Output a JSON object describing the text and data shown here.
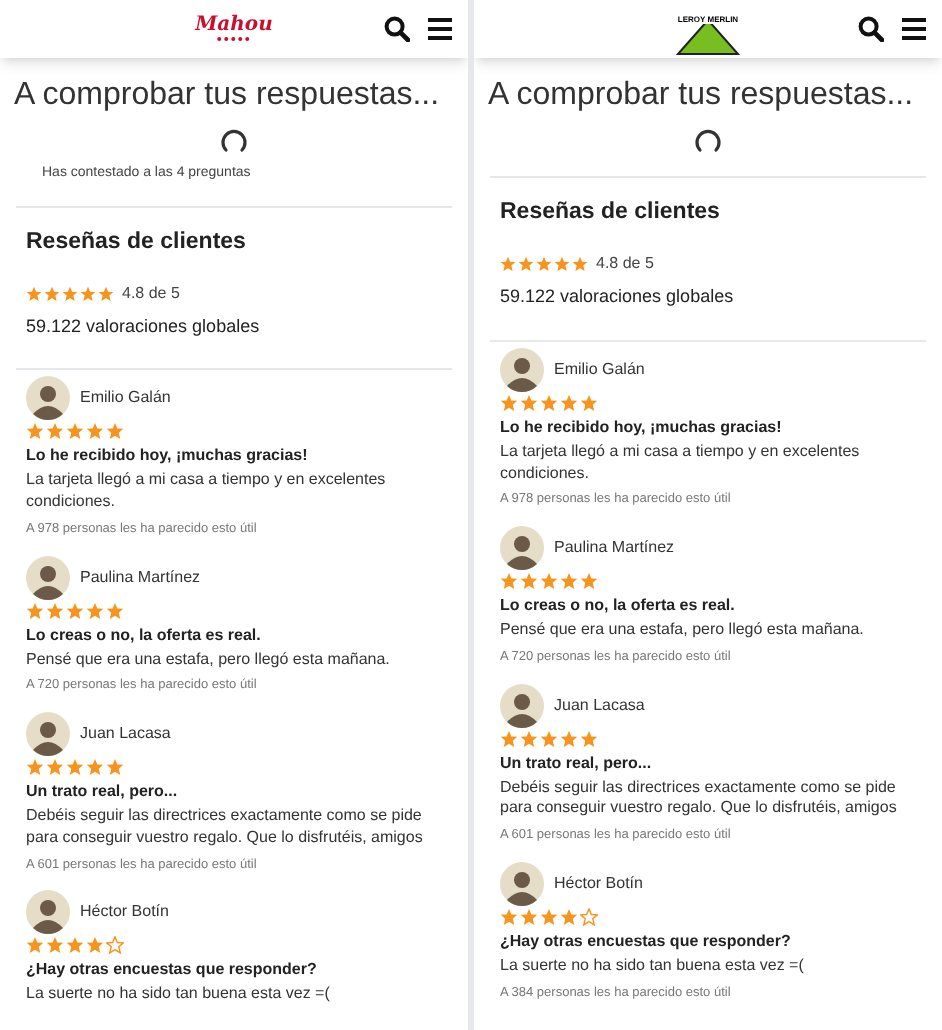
{
  "panels": [
    {
      "logo": {
        "kind": "mahou",
        "text": "Mahou"
      },
      "title": "A comprobar tus respuestas...",
      "progress_text": "Has contestado a las 4 preguntas",
      "reviews_heading": "Reseñas de clientes",
      "summary": {
        "stars": 5,
        "rating": "4.8 de 5",
        "total": "59.122 valoraciones globales"
      },
      "reviews": [
        {
          "name": "Emilio Galán",
          "stars": 5,
          "title": "Lo he recibido hoy, ¡muchas gracias!",
          "body": "La tarjeta llegó a mi casa a tiempo y en excelentes condiciones.",
          "helpful": "A 978 personas les ha parecido esto útil"
        },
        {
          "name": "Paulina Martínez",
          "stars": 5,
          "title": "Lo creas o no, la oferta es real.",
          "body": "Pensé que era una estafa, pero llegó esta mañana.",
          "helpful": "A 720 personas les ha parecido esto útil"
        },
        {
          "name": "Juan Lacasa",
          "stars": 5,
          "title": "Un trato real, pero...",
          "body": "Debéis seguir las directrices exactamente como se pide para conseguir vuestro regalo. Que lo disfrutéis, amigos",
          "helpful": "A 601 personas les ha parecido esto útil"
        },
        {
          "name": "Héctor Botín",
          "stars": 4,
          "title": "¿Hay otras encuestas que responder?",
          "body": "La suerte no ha sido tan buena esta vez =("
        }
      ]
    },
    {
      "logo": {
        "kind": "leroy",
        "text": "LEROY MERLIN"
      },
      "title": "A comprobar tus respuestas...",
      "reviews_heading": "Reseñas de clientes",
      "summary": {
        "stars": 5,
        "rating": "4.8 de 5",
        "total": "59.122 valoraciones globales"
      },
      "reviews": [
        {
          "name": "Emilio Galán",
          "stars": 5,
          "title": "Lo he recibido hoy, ¡muchas gracias!",
          "body": "La tarjeta llegó a mi casa a tiempo y en excelentes condiciones.",
          "helpful": "A 978 personas les ha parecido esto útil"
        },
        {
          "name": "Paulina Martínez",
          "stars": 5,
          "title": "Lo creas o no, la oferta es real.",
          "body": "Pensé que era una estafa, pero llegó esta mañana.",
          "helpful": "A 720 personas les ha parecido esto útil"
        },
        {
          "name": "Juan Lacasa",
          "stars": 5,
          "title": "Un trato real, pero...",
          "body": "Debéis seguir las directrices exactamente como se pide para conseguir vuestro regalo. Que lo disfrutéis, amigos",
          "helpful": "A 601 personas les ha parecido esto útil"
        },
        {
          "name": "Héctor Botín",
          "stars": 4,
          "title": "¿Hay otras encuestas que responder?",
          "body": "La suerte no ha sido tan buena esta vez =(",
          "helpful": "A 384 personas les ha parecido esto útil"
        }
      ]
    }
  ]
}
